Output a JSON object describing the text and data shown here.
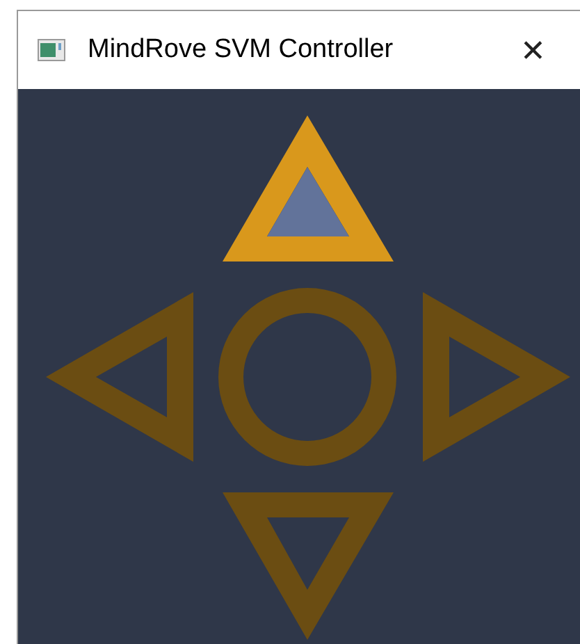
{
  "window": {
    "title": "MindRove SVM Controller",
    "close": "✕"
  },
  "controls": [
    {
      "kind": "up",
      "selected": true
    },
    {
      "kind": "left",
      "selected": false
    },
    {
      "kind": "center",
      "selected": false
    },
    {
      "kind": "right",
      "selected": false
    },
    {
      "kind": "down",
      "selected": false
    }
  ]
}
